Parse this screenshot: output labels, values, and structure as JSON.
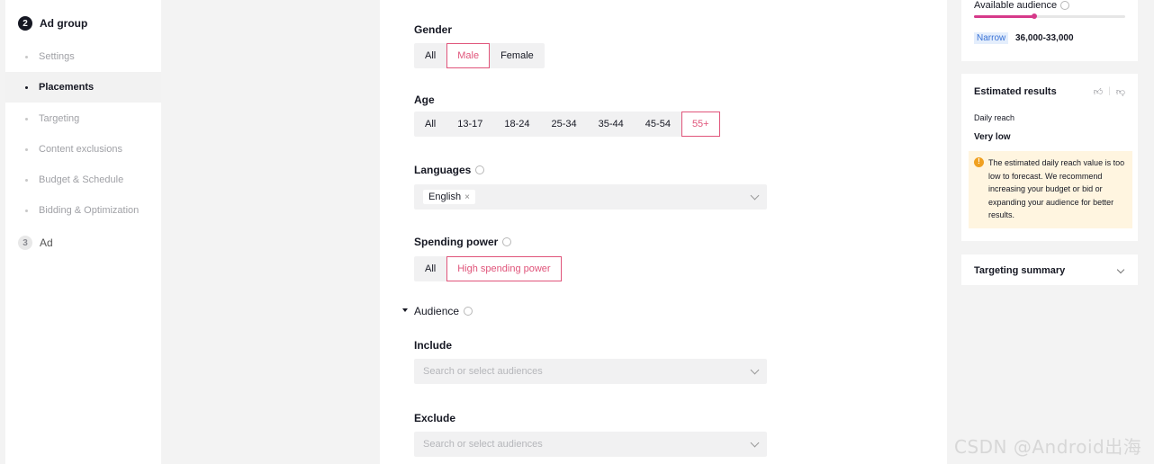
{
  "sidebar": {
    "ad_group": {
      "number": "2",
      "label": "Ad group"
    },
    "items": [
      {
        "label": "Settings"
      },
      {
        "label": "Placements"
      },
      {
        "label": "Targeting"
      },
      {
        "label": "Content exclusions"
      },
      {
        "label": "Budget & Schedule"
      },
      {
        "label": "Bidding & Optimization"
      }
    ],
    "ad": {
      "number": "3",
      "label": "Ad"
    }
  },
  "main": {
    "gender": {
      "label": "Gender",
      "options": [
        "All",
        "Male",
        "Female"
      ],
      "selected": "Male"
    },
    "age": {
      "label": "Age",
      "options": [
        "All",
        "13-17",
        "18-24",
        "25-34",
        "35-44",
        "45-54",
        "55+"
      ],
      "selected": "55+"
    },
    "languages": {
      "label": "Languages",
      "tag": "English",
      "tag_remove": "×"
    },
    "spending_power": {
      "label": "Spending power",
      "options": [
        "All",
        "High spending power"
      ],
      "selected": "High spending power"
    },
    "audience": {
      "label": "Audience",
      "include": {
        "label": "Include",
        "placeholder": "Search or select audiences"
      },
      "exclude": {
        "label": "Exclude",
        "placeholder": "Search or select audiences"
      }
    }
  },
  "right": {
    "available_audience": {
      "title": "Available audience",
      "level": 0.4,
      "badge": "Narrow",
      "range": "36,000-33,000"
    },
    "estimated_results": {
      "title": "Estimated results",
      "daily_reach_label": "Daily reach",
      "daily_reach_value": "Very low",
      "warning_icon": "!",
      "warning": "The estimated daily reach value is too low to forecast. We recommend increasing your budget or bid or expanding your audience for better results."
    },
    "targeting_summary": {
      "title": "Targeting summary"
    }
  },
  "watermark": "CSDN @Android出海",
  "colors": {
    "accent": "#e0547a",
    "bar": "#d63a8a",
    "warning_bg": "#fff5e0",
    "narrow": "#3a73d6"
  }
}
